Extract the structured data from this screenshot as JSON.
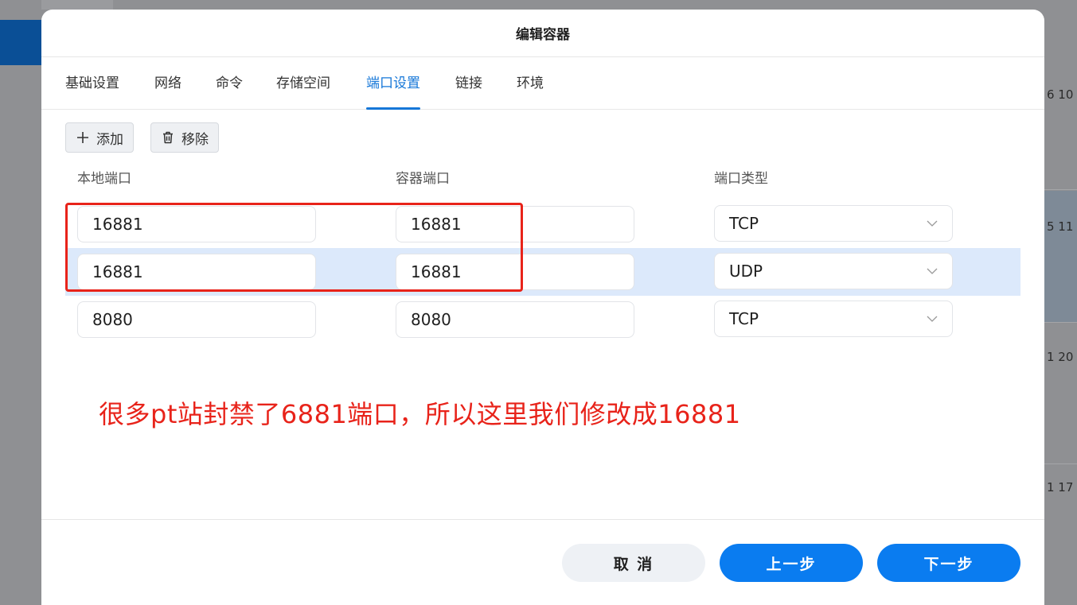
{
  "background": {
    "rows": [
      "6 10",
      "5 11",
      "1 20",
      "1 17"
    ]
  },
  "dialog": {
    "title": "编辑容器",
    "tabs": [
      {
        "label": "基础设置"
      },
      {
        "label": "网络"
      },
      {
        "label": "命令"
      },
      {
        "label": "存储空间"
      },
      {
        "label": "端口设置"
      },
      {
        "label": "链接"
      },
      {
        "label": "环境"
      }
    ],
    "active_tab": "端口设置",
    "toolbar": {
      "add_label": "添加",
      "remove_label": "移除"
    },
    "columns": {
      "local_port": "本地端口",
      "container_port": "容器端口",
      "port_type": "端口类型"
    },
    "ports": [
      {
        "local": "16881",
        "container": "16881",
        "type": "TCP"
      },
      {
        "local": "16881",
        "container": "16881",
        "type": "UDP"
      },
      {
        "local": "8080",
        "container": "8080",
        "type": "TCP"
      }
    ],
    "annotation": "很多pt站封禁了6881端口，所以这里我们修改成16881",
    "buttons": {
      "cancel": "取 消",
      "prev": "上一步",
      "next": "下一步"
    }
  },
  "colors": {
    "accent": "#0a7cf0",
    "annotation": "#e8231a",
    "row_highlight": "#dce9fb"
  }
}
